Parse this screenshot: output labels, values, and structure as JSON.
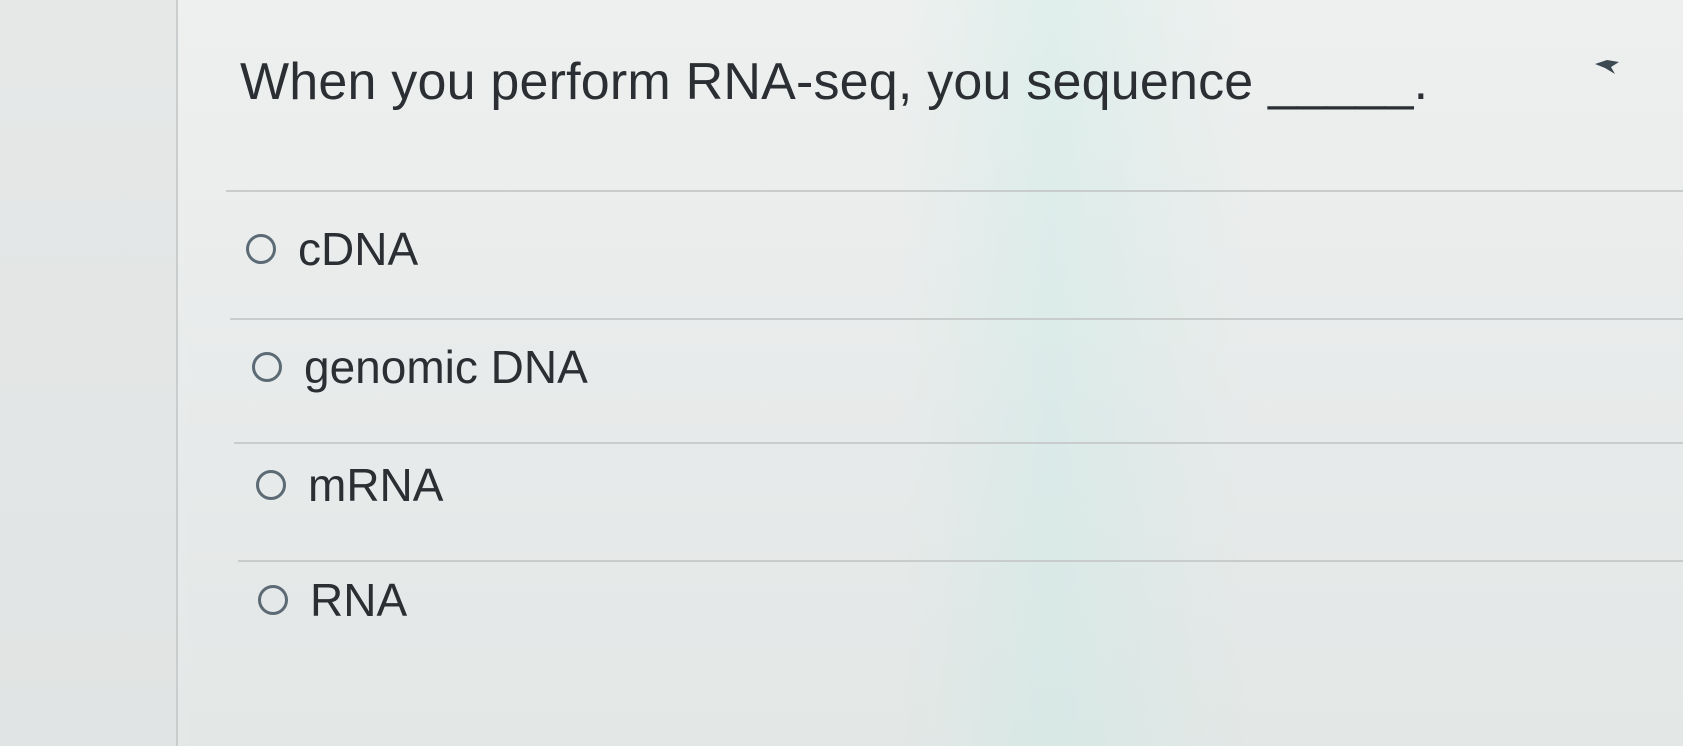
{
  "question": {
    "text": "When you perform RNA-seq, you sequence _____."
  },
  "answers": [
    {
      "label": "cDNA"
    },
    {
      "label": "genomic DNA"
    },
    {
      "label": "mRNA"
    },
    {
      "label": "RNA"
    }
  ],
  "colors": {
    "text": "#2b2f33",
    "radio_border": "#5b6a74",
    "divider": "#c8cccc"
  },
  "icons": {
    "flag": "flag-icon"
  }
}
